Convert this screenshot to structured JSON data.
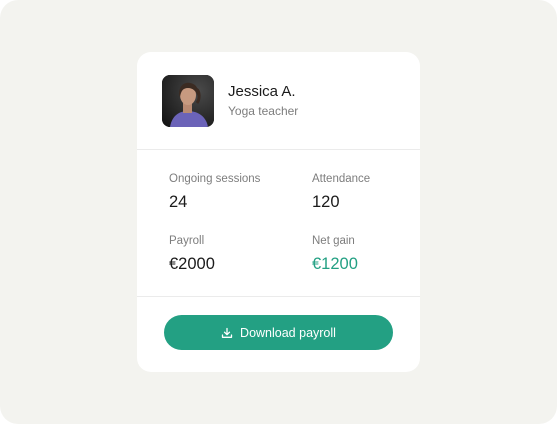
{
  "profile": {
    "name": "Jessica A.",
    "role": "Yoga teacher"
  },
  "stats": [
    {
      "label": "Ongoing sessions",
      "value": "24"
    },
    {
      "label": "Attendance",
      "value": "120"
    },
    {
      "label": "Payroll",
      "value": "€2000"
    },
    {
      "label": "Net gain",
      "value": "€1200"
    }
  ],
  "action": {
    "label": "Download payroll",
    "icon": "download-icon"
  },
  "colors": {
    "background": "#f3f3ef",
    "card": "#ffffff",
    "accent": "#23a083",
    "text": "#1b1b1b",
    "muted": "#7d7d7d"
  }
}
